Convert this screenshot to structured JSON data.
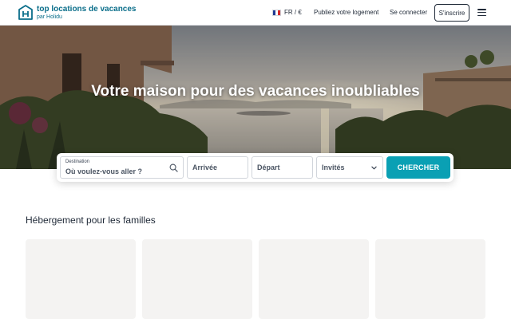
{
  "header": {
    "brand_name": "top locations de vacances",
    "brand_sub": "par Holidu",
    "language": "FR / €",
    "publish_link": "Publiez votre logement",
    "login_link": "Se connecter",
    "signup_button": "S'inscrire"
  },
  "hero": {
    "title": "Votre maison pour des vacances inoubliables"
  },
  "search": {
    "destination_label": "Destination",
    "destination_placeholder": "Où voulez-vous aller ?",
    "arrival": "Arrivée",
    "departure": "Départ",
    "guests": "Invités",
    "submit": "CHERCHER"
  },
  "section": {
    "title": "Hébergement pour les familles",
    "cards": [
      "",
      "",
      "",
      ""
    ]
  },
  "colors": {
    "brand": "#0a6e8a",
    "accent": "#0aa0b4",
    "card_placeholder": "#f4f3f2"
  },
  "icons": {
    "logo": "house-logo-icon",
    "flag": "france-flag-icon",
    "menu": "hamburger-menu-icon",
    "search": "search-icon",
    "dropdown": "chevron-down-icon"
  }
}
